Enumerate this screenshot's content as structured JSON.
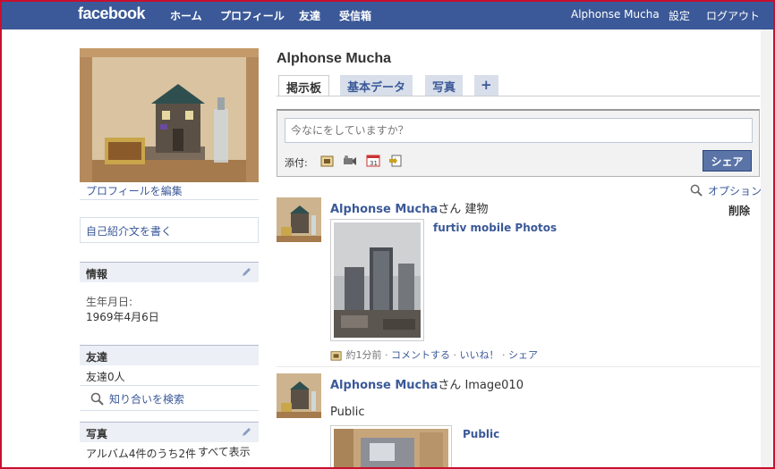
{
  "topbar": {
    "logo": "facebook",
    "nav": [
      "ホーム",
      "プロフィール",
      "友達",
      "受信箱"
    ],
    "user": "Alphonse Mucha",
    "settings": "設定",
    "logout": "ログアウト"
  },
  "left": {
    "edit_profile": "プロフィールを編集",
    "write_bio": "自己紹介文を書く",
    "info": {
      "title": "情報",
      "birthday_label": "生年月日:",
      "birthday_value": "1969年4月6日"
    },
    "friends": {
      "title": "友達",
      "count": "友達0人",
      "search": "知り合いを検索"
    },
    "photos": {
      "title": "写真",
      "albums": "アルバム4件のうち2件",
      "see_all": "すべて表示"
    }
  },
  "main": {
    "name": "Alphonse Mucha",
    "tabs": [
      "掲示板",
      "基本データ",
      "写真",
      "+"
    ],
    "composer": {
      "placeholder": "今なにをしていますか？",
      "attach_label": "添付:",
      "share": "シェア"
    },
    "options": "オプション",
    "delete": "削除",
    "stories": [
      {
        "author": "Alphonse Mucha",
        "suffix": "さん",
        "text": "建物",
        "app_link": "furtiv mobile Photos",
        "time": "約1分前",
        "actions": [
          "コメントする",
          "いいね！",
          "シェア"
        ]
      },
      {
        "author": "Alphonse Mucha",
        "suffix": "さん",
        "text": "Image010",
        "body": "Public",
        "link": "Public"
      }
    ]
  },
  "colors": {
    "brand": "#3b5998",
    "header_bg": "#eceff5",
    "tab_bg": "#d8dfea"
  }
}
